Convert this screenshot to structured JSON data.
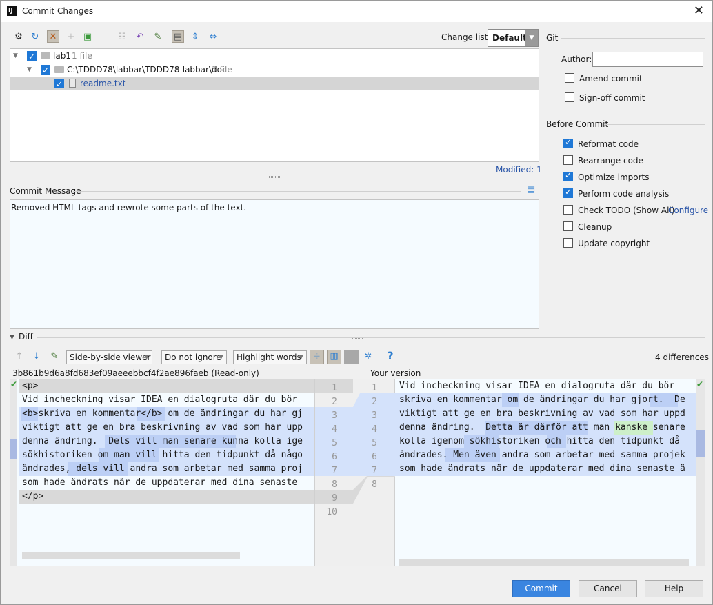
{
  "window": {
    "title": "Commit Changes",
    "close": "✕"
  },
  "toolbar": {
    "change_list_label": "Change list:",
    "change_list_value": "Default"
  },
  "tree": {
    "rows": [
      {
        "name": "lab1",
        "meta": "1 file"
      },
      {
        "name": "C:\\TDDD78\\labbar\\TDDD78-labbar\\doc",
        "meta": "1 file"
      },
      {
        "name": "readme.txt",
        "meta": ""
      }
    ],
    "modified": "Modified: 1"
  },
  "commit_message": {
    "label": "Commit Message",
    "text": "Removed HTML-tags and rewrote some parts of the text."
  },
  "git": {
    "section": "Git",
    "author_label": "Author:",
    "author_value": "",
    "amend": "Amend commit",
    "signoff": "Sign-off commit"
  },
  "before_commit": {
    "section": "Before Commit",
    "options": [
      {
        "label": "Reformat code",
        "checked": true
      },
      {
        "label": "Rearrange code",
        "checked": false
      },
      {
        "label": "Optimize imports",
        "checked": true
      },
      {
        "label": "Perform code analysis",
        "checked": true
      },
      {
        "label": "Check TODO (Show All)",
        "checked": false
      },
      {
        "label": "Cleanup",
        "checked": false
      },
      {
        "label": "Update copyright",
        "checked": false
      }
    ],
    "configure_link": "Configure"
  },
  "diff": {
    "label": "Diff",
    "viewer": "Side-by-side viewer",
    "ignore": "Do not ignore",
    "highlight": "Highlight words",
    "differences": "4 differences",
    "help": "?",
    "left_header": "3b861b9d6a8fd683ef09aeeebbcf4f2ae896faeb (Read-only)",
    "right_header": "Your version",
    "left_lines": [
      "<p>",
      "Vid incheckning visar IDEA en dialogruta där du bör",
      "<b>skriva en kommentar</b> om de ändringar du har gj",
      "viktigt att ge en bra beskrivning av vad som har upp",
      "denna ändring.  Dels vill man senare kunna kolla ige",
      "sökhistoriken om man vill hitta den tidpunkt då någo",
      "ändrades, dels vill andra som arbetar med samma proj",
      "som hade ändrats när de uppdaterar med dina senaste",
      "</p>"
    ],
    "right_lines": [
      "Vid incheckning visar IDEA en dialogruta där du bör",
      "skriva en kommentar om de ändringar du har gjort.  De",
      "viktigt att ge en bra beskrivning av vad som har uppd",
      "denna ändring.  Detta är därför att man kanske senare",
      "kolla igenom sökhistoriken och hitta den tidpunkt då",
      "ändrades. Men även andra som arbetar med samma projek",
      "som hade ändrats när de uppdaterar med dina senaste ä"
    ],
    "left_numbers": [
      "1",
      "2",
      "3",
      "4",
      "5",
      "6",
      "7",
      "8",
      "9",
      "10"
    ],
    "right_numbers": [
      "1",
      "2",
      "3",
      "4",
      "5",
      "6",
      "7",
      "8"
    ]
  },
  "buttons": {
    "commit": "Commit",
    "cancel": "Cancel",
    "help": "Help"
  },
  "colors": {
    "accent": "#3a85e0",
    "checkbox": "#1f78d6",
    "link": "#2a55a8",
    "diff_changed": "#d4e2fb",
    "diff_added_word": "#cdefc9"
  }
}
